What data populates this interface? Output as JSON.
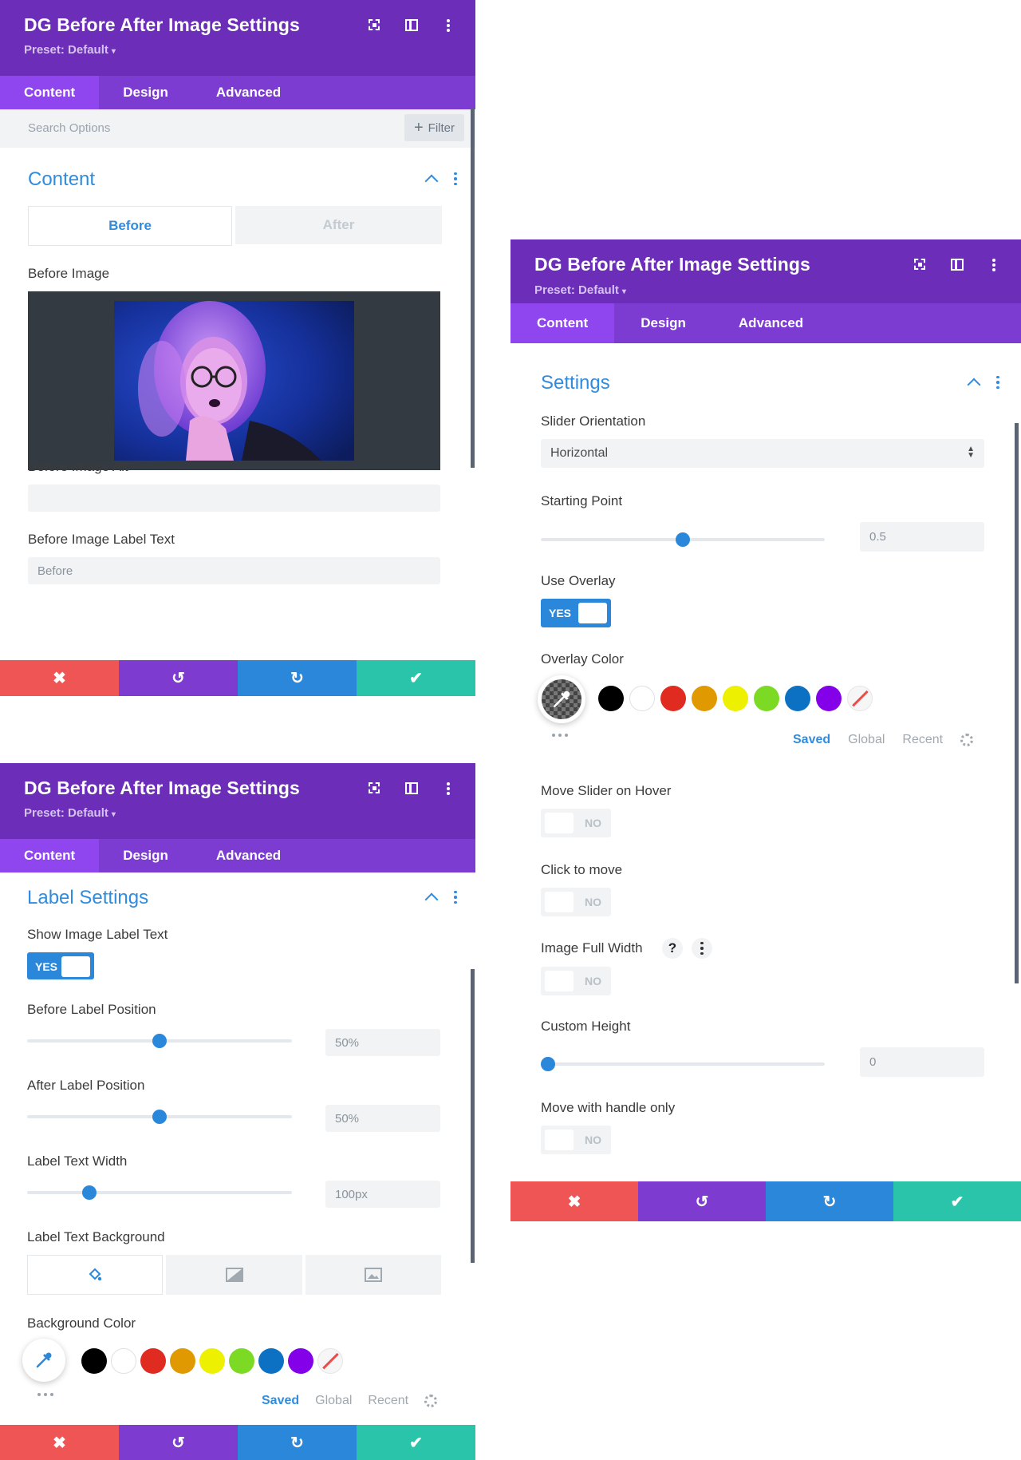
{
  "panels": {
    "title": "DG Before After Image Settings",
    "preset": "Preset: Default",
    "tabs": [
      "Content",
      "Design",
      "Advanced"
    ]
  },
  "panel1": {
    "search_placeholder": "Search Options",
    "filter_label": "Filter",
    "section_title": "Content",
    "before_tab": "Before",
    "after_tab": "After",
    "before_image_label": "Before Image",
    "before_image_alt_label": "Before Image Alt",
    "before_image_alt_value": "",
    "before_label_text_label": "Before Image Label Text",
    "before_label_text_value": "Before"
  },
  "panel2": {
    "section_title": "Label Settings",
    "show_label_text": "Show Image Label Text",
    "show_label_toggle": "YES",
    "before_label_position": "Before Label Position",
    "before_label_position_value": "50%",
    "before_label_position_fraction": 0.5,
    "after_label_position": "After Label Position",
    "after_label_position_value": "50%",
    "after_label_position_fraction": 0.5,
    "label_text_width": "Label Text Width",
    "label_text_width_value": "100px",
    "label_text_width_fraction": 0.22,
    "label_text_background": "Label Text Background",
    "background_color": "Background Color",
    "palette_tabs": [
      "Saved",
      "Global",
      "Recent"
    ]
  },
  "panel3": {
    "section_title": "Settings",
    "slider_orientation": "Slider Orientation",
    "slider_orientation_value": "Horizontal",
    "starting_point": "Starting Point",
    "starting_point_value": "0.5",
    "starting_point_fraction": 0.5,
    "use_overlay": "Use Overlay",
    "use_overlay_toggle": "YES",
    "overlay_color": "Overlay Color",
    "palette_tabs": [
      "Saved",
      "Global",
      "Recent"
    ],
    "move_slider_on_hover": "Move Slider on Hover",
    "move_slider_on_hover_toggle": "NO",
    "click_to_move": "Click to move",
    "click_to_move_toggle": "NO",
    "image_full_width": "Image Full Width",
    "image_full_width_help": "?",
    "image_full_width_toggle": "NO",
    "custom_height": "Custom Height",
    "custom_height_value": "0",
    "custom_height_fraction": 0,
    "move_with_handle_only": "Move with handle only",
    "move_with_handle_only_toggle": "NO"
  },
  "palette_colors": [
    "#000000",
    "#ffffff",
    "#e02b20",
    "#e09900",
    "#edf000",
    "#7cda24",
    "#0c71c3",
    "#8300e9"
  ],
  "action_icons": [
    "close-icon",
    "undo-icon",
    "redo-icon",
    "check-icon"
  ],
  "colors": {
    "header": "#6c2eb9",
    "tabs": "#7c3bd1",
    "tab_active": "#8f46ef",
    "accent_blue": "#2b87da",
    "cancel": "#ef5555",
    "save": "#29c4a9"
  }
}
